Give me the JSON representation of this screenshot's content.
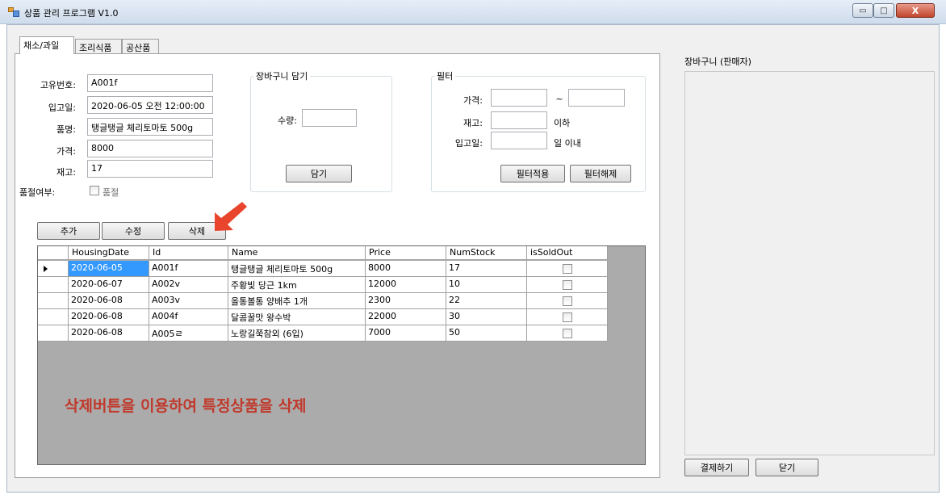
{
  "window": {
    "title": "상품 관리 프로그램 V1.0",
    "min_icon": "▭",
    "max_icon": "□",
    "close_icon": "X"
  },
  "tabs": [
    {
      "label": "채소/과일",
      "active": true
    },
    {
      "label": "조리식품",
      "active": false
    },
    {
      "label": "공산품",
      "active": false
    }
  ],
  "form": {
    "id_label": "고유번호:",
    "id_value": "A001f",
    "date_label": "입고일:",
    "date_value": "2020-06-05 오전 12:00:00",
    "name_label": "품명:",
    "name_value": "탱글탱글 체리토마토 500g",
    "price_label": "가격:",
    "price_value": "8000",
    "stock_label": "재고:",
    "stock_value": "17",
    "soldout_label": "품절여부:",
    "soldout_check_label": "품절"
  },
  "cart_group": {
    "title": "장바구니 담기",
    "qty_label": "수량:",
    "qty_value": "",
    "add_button": "담기"
  },
  "filter": {
    "title": "필터",
    "price_label": "가격:",
    "tilde": "~",
    "price_from": "",
    "price_to": "",
    "stock_label": "재고:",
    "stock_value": "",
    "stock_suffix": "이하",
    "date_label": "입고일:",
    "date_value": "",
    "date_suffix": "일 이내",
    "apply_button": "필터적용",
    "clear_button": "필터해제"
  },
  "actions": {
    "add": "추가",
    "edit": "수정",
    "delete": "삭제"
  },
  "grid": {
    "columns": [
      "HousingDate",
      "Id",
      "Name",
      "Price",
      "NumStock",
      "isSoldOut"
    ],
    "rows": [
      {
        "date": "2020-06-05",
        "id": "A001f",
        "name": "탱글탱글 체리토마토 500g",
        "price": "8000",
        "stock": "17",
        "soldout": false
      },
      {
        "date": "2020-06-07",
        "id": "A002v",
        "name": "주황빛 당근 1km",
        "price": "12000",
        "stock": "10",
        "soldout": false
      },
      {
        "date": "2020-06-08",
        "id": "A003v",
        "name": "올통볼통 양배추 1개",
        "price": "2300",
        "stock": "22",
        "soldout": false
      },
      {
        "date": "2020-06-08",
        "id": "A004f",
        "name": "달콤꿀맛 왕수박",
        "price": "22000",
        "stock": "30",
        "soldout": false
      },
      {
        "date": "2020-06-08",
        "id": "A005ㄹ",
        "name": "노랑길쭉참외 (6입)",
        "price": "7000",
        "stock": "50",
        "soldout": false
      }
    ]
  },
  "annotation": "삭제버튼을 이용하여 특정상품을 삭제",
  "cart": {
    "title": "장바구니 (판매자)",
    "pay_button": "결제하기",
    "close_button": "닫기"
  },
  "colors": {
    "accent_arrow": "#e8452c",
    "annotation": "#c0392b",
    "selection": "#3399ff"
  }
}
